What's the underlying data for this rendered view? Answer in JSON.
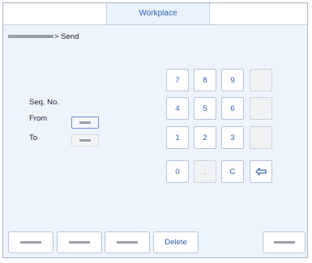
{
  "header": {
    "tabs": [
      {
        "label": "Workplace",
        "active": true
      }
    ]
  },
  "breadcrumb": {
    "current": "> Send"
  },
  "range": {
    "title": "Seq. No.",
    "from_label": "From",
    "to_label": "To"
  },
  "keypad": {
    "keys": [
      "7",
      "8",
      "9",
      "4",
      "5",
      "6",
      "1",
      "2",
      "3",
      "0",
      ".",
      "C"
    ],
    "backspace_icon": "backspace-arrow-icon"
  },
  "footer": {
    "delete_label": "Delete"
  }
}
